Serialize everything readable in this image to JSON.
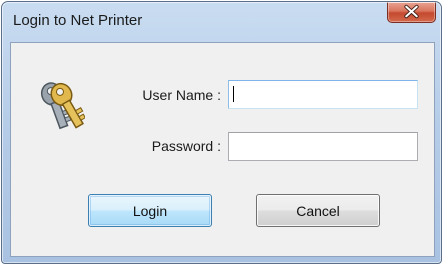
{
  "window": {
    "title": "Login to Net Printer",
    "close_icon": "close-icon"
  },
  "form": {
    "icon": "keys-icon",
    "username_label": "User Name :",
    "username_value": "",
    "password_label": "Password :",
    "password_value": ""
  },
  "buttons": {
    "login_label": "Login",
    "cancel_label": "Cancel"
  },
  "colors": {
    "titlebar": "#b6cde8",
    "close_button": "#c44a2e",
    "client_bg": "#f0f0f0",
    "focused_button_border": "#3c7fb1"
  }
}
